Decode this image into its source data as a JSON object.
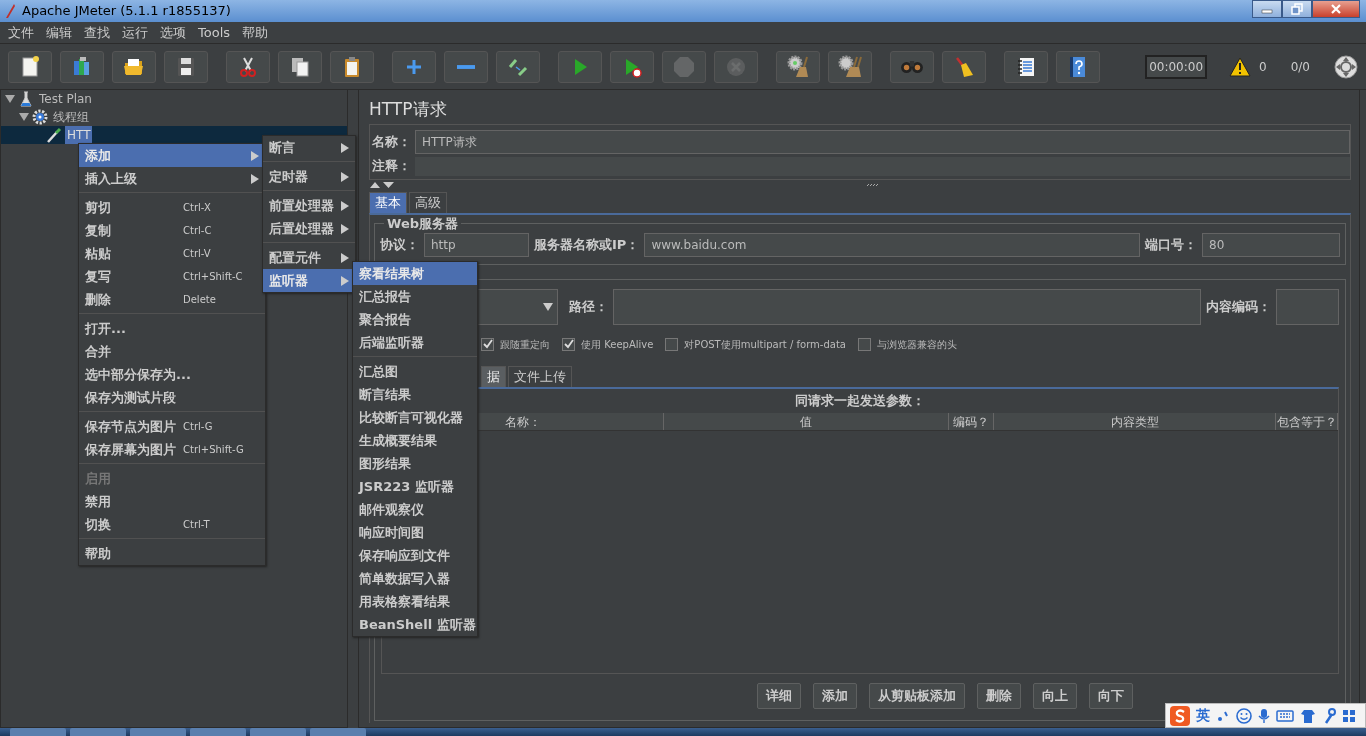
{
  "window": {
    "title": "Apache JMeter (5.1.1 r1855137)"
  },
  "menu_bar": [
    "文件",
    "编辑",
    "查找",
    "运行",
    "选项",
    "Tools",
    "帮助"
  ],
  "toolbar": [
    {
      "kind": "new",
      "disabled": false
    },
    {
      "kind": "templates",
      "disabled": false
    },
    {
      "kind": "open",
      "disabled": false
    },
    {
      "kind": "save",
      "disabled": false
    },
    {
      "kind": "gap"
    },
    {
      "kind": "cut",
      "disabled": false
    },
    {
      "kind": "copy",
      "disabled": false
    },
    {
      "kind": "paste",
      "disabled": false
    },
    {
      "kind": "gap"
    },
    {
      "kind": "expand",
      "disabled": false
    },
    {
      "kind": "collapse",
      "disabled": false
    },
    {
      "kind": "toggle",
      "disabled": false
    },
    {
      "kind": "gap"
    },
    {
      "kind": "start",
      "disabled": false
    },
    {
      "kind": "start_no_timers",
      "disabled": false
    },
    {
      "kind": "stop",
      "disabled": true
    },
    {
      "kind": "shutdown",
      "disabled": true
    },
    {
      "kind": "gap"
    },
    {
      "kind": "clear",
      "disabled": false
    },
    {
      "kind": "clear_all",
      "disabled": false
    },
    {
      "kind": "gap"
    },
    {
      "kind": "search",
      "disabled": false
    },
    {
      "kind": "reset_search",
      "disabled": false
    },
    {
      "kind": "gap"
    },
    {
      "kind": "function_helper",
      "disabled": false
    },
    {
      "kind": "help",
      "disabled": false
    }
  ],
  "status": {
    "timer": "00:00:00",
    "warnings": "0",
    "threads": "0/0"
  },
  "tree": [
    {
      "label": "Test Plan",
      "kind": "plan",
      "expanded": true,
      "selected": false,
      "children": [
        {
          "label": "线程组",
          "kind": "thread_group",
          "expanded": true,
          "selected": false,
          "children": [
            {
              "label": "HTT",
              "kind": "sampler",
              "selected": true
            }
          ]
        }
      ]
    }
  ],
  "context_menu": [
    {
      "kind": "item",
      "label": "添加",
      "submenu": true,
      "selected": true,
      "disabled": false
    },
    {
      "kind": "item",
      "label": "插入上级",
      "submenu": true,
      "selected": false,
      "disabled": false
    },
    {
      "kind": "separator"
    },
    {
      "kind": "item",
      "label": "剪切",
      "shortcut": "Ctrl-X",
      "selected": false,
      "disabled": false
    },
    {
      "kind": "item",
      "label": "复制",
      "shortcut": "Ctrl-C",
      "selected": false,
      "disabled": false
    },
    {
      "kind": "item",
      "label": "粘贴",
      "shortcut": "Ctrl-V",
      "selected": false,
      "disabled": false
    },
    {
      "kind": "item",
      "label": "复写",
      "shortcut": "Ctrl+Shift-C",
      "selected": false,
      "disabled": false
    },
    {
      "kind": "item",
      "label": "删除",
      "shortcut": "Delete",
      "selected": false,
      "disabled": false
    },
    {
      "kind": "separator"
    },
    {
      "kind": "item",
      "label": "打开...",
      "selected": false,
      "disabled": false
    },
    {
      "kind": "item",
      "label": "合并",
      "selected": false,
      "disabled": false
    },
    {
      "kind": "item",
      "label": "选中部分保存为...",
      "selected": false,
      "disabled": false
    },
    {
      "kind": "item",
      "label": "保存为测试片段",
      "selected": false,
      "disabled": false
    },
    {
      "kind": "separator"
    },
    {
      "kind": "item",
      "label": "保存节点为图片",
      "shortcut": "Ctrl-G",
      "selected": false,
      "disabled": false
    },
    {
      "kind": "item",
      "label": "保存屏幕为图片",
      "shortcut": "Ctrl+Shift-G",
      "selected": false,
      "disabled": false
    },
    {
      "kind": "separator"
    },
    {
      "kind": "item",
      "label": "启用",
      "selected": false,
      "disabled": true
    },
    {
      "kind": "item",
      "label": "禁用",
      "selected": false,
      "disabled": false
    },
    {
      "kind": "item",
      "label": "切换",
      "shortcut": "Ctrl-T",
      "selected": false,
      "disabled": false
    },
    {
      "kind": "separator"
    },
    {
      "kind": "item",
      "label": "帮助",
      "selected": false,
      "disabled": false
    }
  ],
  "add_submenu": [
    {
      "kind": "item",
      "label": "断言",
      "submenu": true,
      "selected": false
    },
    {
      "kind": "separator"
    },
    {
      "kind": "item",
      "label": "定时器",
      "submenu": true,
      "selected": false
    },
    {
      "kind": "separator"
    },
    {
      "kind": "item",
      "label": "前置处理器",
      "submenu": true,
      "selected": false
    },
    {
      "kind": "item",
      "label": "后置处理器",
      "submenu": true,
      "selected": false
    },
    {
      "kind": "separator"
    },
    {
      "kind": "item",
      "label": "配置元件",
      "submenu": true,
      "selected": false
    },
    {
      "kind": "item",
      "label": "监听器",
      "submenu": true,
      "selected": true
    }
  ],
  "listener_submenu": [
    {
      "kind": "item",
      "label": "察看结果树",
      "selected": true
    },
    {
      "kind": "item",
      "label": "汇总报告",
      "selected": false
    },
    {
      "kind": "item",
      "label": "聚合报告",
      "selected": false
    },
    {
      "kind": "item",
      "label": "后端监听器",
      "selected": false
    },
    {
      "kind": "separator"
    },
    {
      "kind": "item",
      "label": "汇总图",
      "selected": false
    },
    {
      "kind": "item",
      "label": "断言结果",
      "selected": false
    },
    {
      "kind": "item",
      "label": "比较断言可视化器",
      "selected": false
    },
    {
      "kind": "item",
      "label": "生成概要结果",
      "selected": false
    },
    {
      "kind": "item",
      "label": "图形结果",
      "selected": false
    },
    {
      "kind": "item",
      "label": "JSR223 监听器",
      "selected": false
    },
    {
      "kind": "item",
      "label": "邮件观察仪",
      "selected": false
    },
    {
      "kind": "item",
      "label": "响应时间图",
      "selected": false
    },
    {
      "kind": "item",
      "label": "保存响应到文件",
      "selected": false
    },
    {
      "kind": "item",
      "label": "简单数据写入器",
      "selected": false
    },
    {
      "kind": "item",
      "label": "用表格察看结果",
      "selected": false
    },
    {
      "kind": "item",
      "label": "BeanShell 监听器",
      "selected": false
    }
  ],
  "panel": {
    "title": "HTTP请求",
    "name_label": "名称：",
    "name_value": "HTTP请求",
    "comment_label": "注释：",
    "tabs": [
      {
        "label": "基本",
        "selected": true
      },
      {
        "label": "高级",
        "selected": false
      }
    ],
    "web_server": {
      "legend": "Web服务器",
      "protocol_label": "协议：",
      "protocol": "http",
      "server_label": "服务器名称或IP：",
      "server": "www.baidu.com",
      "port_label": "端口号：",
      "port": "80"
    },
    "request": {
      "path_label": "路径：",
      "encoding_label": "内容编码：",
      "options": [
        {
          "label": "跟随重定向",
          "checked": true
        },
        {
          "label": "使用 KeepAlive",
          "checked": true
        },
        {
          "label": "对POST使用multipart / form-data",
          "checked": false
        },
        {
          "label": "与浏览器兼容的头",
          "checked": false
        }
      ],
      "tabs": [
        {
          "label": "据",
          "selected": true
        },
        {
          "label": "文件上传",
          "selected": false
        }
      ],
      "table": {
        "title": "同请求一起发送参数：",
        "columns": [
          "名称：",
          "值",
          "编码？",
          "内容类型",
          "包含等于？"
        ]
      },
      "buttons": [
        "详细",
        "添加",
        "从剪贴板添加",
        "删除",
        "向上",
        "向下"
      ]
    }
  },
  "ime_toolbar": {
    "mode": "英"
  }
}
